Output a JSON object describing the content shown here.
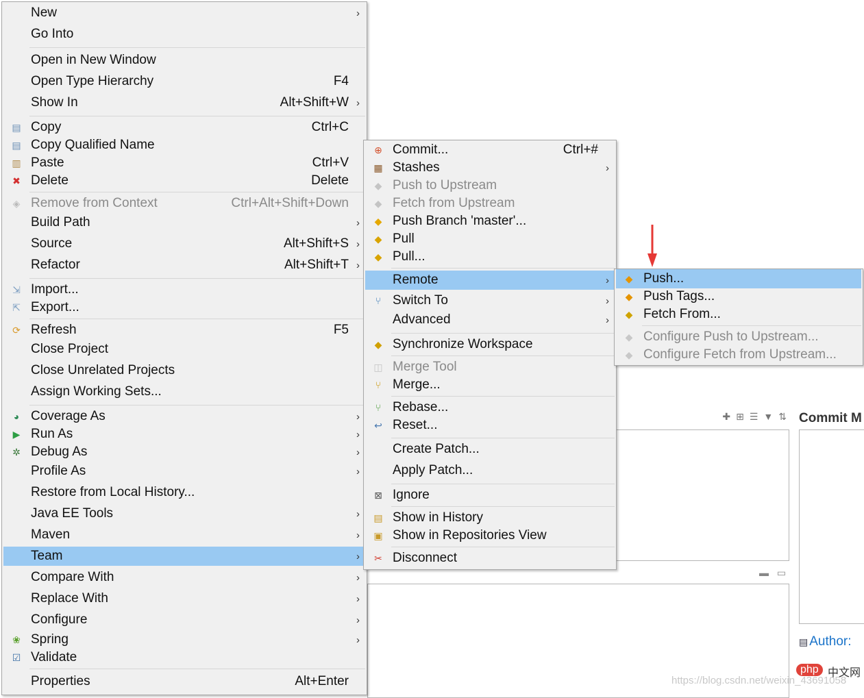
{
  "background": {
    "commit_panel_title": "Commit M",
    "author_label": "Author:",
    "watermark": "https://blog.csdn.net/weixin_43691058",
    "php_badge": "php",
    "php_text": "中文网"
  },
  "main_menu": {
    "items": [
      {
        "label": "New",
        "shortcut": "",
        "submenu": true,
        "icon": ""
      },
      {
        "label": "Go Into",
        "shortcut": "",
        "submenu": false,
        "icon": ""
      },
      {
        "label": "Open in New Window",
        "shortcut": "",
        "submenu": false,
        "icon": ""
      },
      {
        "label": "Open Type Hierarchy",
        "shortcut": "F4",
        "submenu": false,
        "icon": ""
      },
      {
        "label": "Show In",
        "shortcut": "Alt+Shift+W",
        "submenu": true,
        "icon": ""
      },
      {
        "label": "Copy",
        "shortcut": "Ctrl+C",
        "submenu": false,
        "icon": "copy-icon"
      },
      {
        "label": "Copy Qualified Name",
        "shortcut": "",
        "submenu": false,
        "icon": "copy-qualified-icon"
      },
      {
        "label": "Paste",
        "shortcut": "Ctrl+V",
        "submenu": false,
        "icon": "paste-icon"
      },
      {
        "label": "Delete",
        "shortcut": "Delete",
        "submenu": false,
        "icon": "delete-icon"
      },
      {
        "label": "Remove from Context",
        "shortcut": "Ctrl+Alt+Shift+Down",
        "submenu": false,
        "icon": "remove-context-icon",
        "disabled": true
      },
      {
        "label": "Build Path",
        "shortcut": "",
        "submenu": true,
        "icon": ""
      },
      {
        "label": "Source",
        "shortcut": "Alt+Shift+S",
        "submenu": true,
        "icon": ""
      },
      {
        "label": "Refactor",
        "shortcut": "Alt+Shift+T",
        "submenu": true,
        "icon": ""
      },
      {
        "label": "Import...",
        "shortcut": "",
        "submenu": false,
        "icon": "import-icon"
      },
      {
        "label": "Export...",
        "shortcut": "",
        "submenu": false,
        "icon": "export-icon"
      },
      {
        "label": "Refresh",
        "shortcut": "F5",
        "submenu": false,
        "icon": "refresh-icon"
      },
      {
        "label": "Close Project",
        "shortcut": "",
        "submenu": false,
        "icon": ""
      },
      {
        "label": "Close Unrelated Projects",
        "shortcut": "",
        "submenu": false,
        "icon": ""
      },
      {
        "label": "Assign Working Sets...",
        "shortcut": "",
        "submenu": false,
        "icon": ""
      },
      {
        "label": "Coverage As",
        "shortcut": "",
        "submenu": true,
        "icon": "coverage-icon"
      },
      {
        "label": "Run As",
        "shortcut": "",
        "submenu": true,
        "icon": "run-icon"
      },
      {
        "label": "Debug As",
        "shortcut": "",
        "submenu": true,
        "icon": "debug-icon"
      },
      {
        "label": "Profile As",
        "shortcut": "",
        "submenu": true,
        "icon": ""
      },
      {
        "label": "Restore from Local History...",
        "shortcut": "",
        "submenu": false,
        "icon": ""
      },
      {
        "label": "Java EE Tools",
        "shortcut": "",
        "submenu": true,
        "icon": ""
      },
      {
        "label": "Maven",
        "shortcut": "",
        "submenu": true,
        "icon": ""
      },
      {
        "label": "Team",
        "shortcut": "",
        "submenu": true,
        "icon": "",
        "highlighted": true
      },
      {
        "label": "Compare With",
        "shortcut": "",
        "submenu": true,
        "icon": ""
      },
      {
        "label": "Replace With",
        "shortcut": "",
        "submenu": true,
        "icon": ""
      },
      {
        "label": "Configure",
        "shortcut": "",
        "submenu": true,
        "icon": ""
      },
      {
        "label": "Spring",
        "shortcut": "",
        "submenu": true,
        "icon": "spring-icon"
      },
      {
        "label": "Validate",
        "shortcut": "",
        "submenu": false,
        "icon": "validate-check-icon"
      },
      {
        "label": "Properties",
        "shortcut": "Alt+Enter",
        "submenu": false,
        "icon": ""
      }
    ]
  },
  "team_menu": {
    "items": [
      {
        "label": "Commit...",
        "shortcut": "Ctrl+#",
        "submenu": false,
        "icon": "commit-icon"
      },
      {
        "label": "Stashes",
        "shortcut": "",
        "submenu": true,
        "icon": "stashes-icon"
      },
      {
        "label": "Push to Upstream",
        "shortcut": "",
        "submenu": false,
        "icon": "push-upstream-icon",
        "disabled": true
      },
      {
        "label": "Fetch from Upstream",
        "shortcut": "",
        "submenu": false,
        "icon": "fetch-upstream-icon",
        "disabled": true
      },
      {
        "label": "Push Branch 'master'...",
        "shortcut": "",
        "submenu": false,
        "icon": "push-branch-icon"
      },
      {
        "label": "Pull",
        "shortcut": "",
        "submenu": false,
        "icon": "pull-icon"
      },
      {
        "label": "Pull...",
        "shortcut": "",
        "submenu": false,
        "icon": "pull-dialog-icon"
      },
      {
        "label": "Remote",
        "shortcut": "",
        "submenu": true,
        "icon": "",
        "highlighted": true
      },
      {
        "label": "Switch To",
        "shortcut": "",
        "submenu": true,
        "icon": "switch-branch-icon"
      },
      {
        "label": "Advanced",
        "shortcut": "",
        "submenu": true,
        "icon": ""
      },
      {
        "label": "Synchronize Workspace",
        "shortcut": "",
        "submenu": false,
        "icon": "synchronize-icon"
      },
      {
        "label": "Merge Tool",
        "shortcut": "",
        "submenu": false,
        "icon": "merge-tool-icon",
        "disabled": true
      },
      {
        "label": "Merge...",
        "shortcut": "",
        "submenu": false,
        "icon": "merge-icon"
      },
      {
        "label": "Rebase...",
        "shortcut": "",
        "submenu": false,
        "icon": "rebase-icon"
      },
      {
        "label": "Reset...",
        "shortcut": "",
        "submenu": false,
        "icon": "reset-icon"
      },
      {
        "label": "Create Patch...",
        "shortcut": "",
        "submenu": false,
        "icon": ""
      },
      {
        "label": "Apply Patch...",
        "shortcut": "",
        "submenu": false,
        "icon": ""
      },
      {
        "label": "Ignore",
        "shortcut": "",
        "submenu": false,
        "icon": "ignore-icon"
      },
      {
        "label": "Show in History",
        "shortcut": "",
        "submenu": false,
        "icon": "history-icon"
      },
      {
        "label": "Show in Repositories View",
        "shortcut": "",
        "submenu": false,
        "icon": "repositories-icon"
      },
      {
        "label": "Disconnect",
        "shortcut": "",
        "submenu": false,
        "icon": "disconnect-icon"
      }
    ]
  },
  "remote_menu": {
    "items": [
      {
        "label": "Push...",
        "icon": "push-icon",
        "highlighted": true
      },
      {
        "label": "Push Tags...",
        "icon": "push-tags-icon"
      },
      {
        "label": "Fetch From...",
        "icon": "fetch-icon"
      },
      {
        "label": "Configure Push to Upstream...",
        "icon": "configure-push-icon",
        "disabled": true
      },
      {
        "label": "Configure Fetch from Upstream...",
        "icon": "configure-fetch-icon",
        "disabled": true
      }
    ]
  },
  "colors": {
    "menu_bg": "#f0f0f0",
    "highlight": "#99c9f2",
    "disabled_text": "#8a8a8a",
    "annotation_arrow": "#e53935"
  }
}
